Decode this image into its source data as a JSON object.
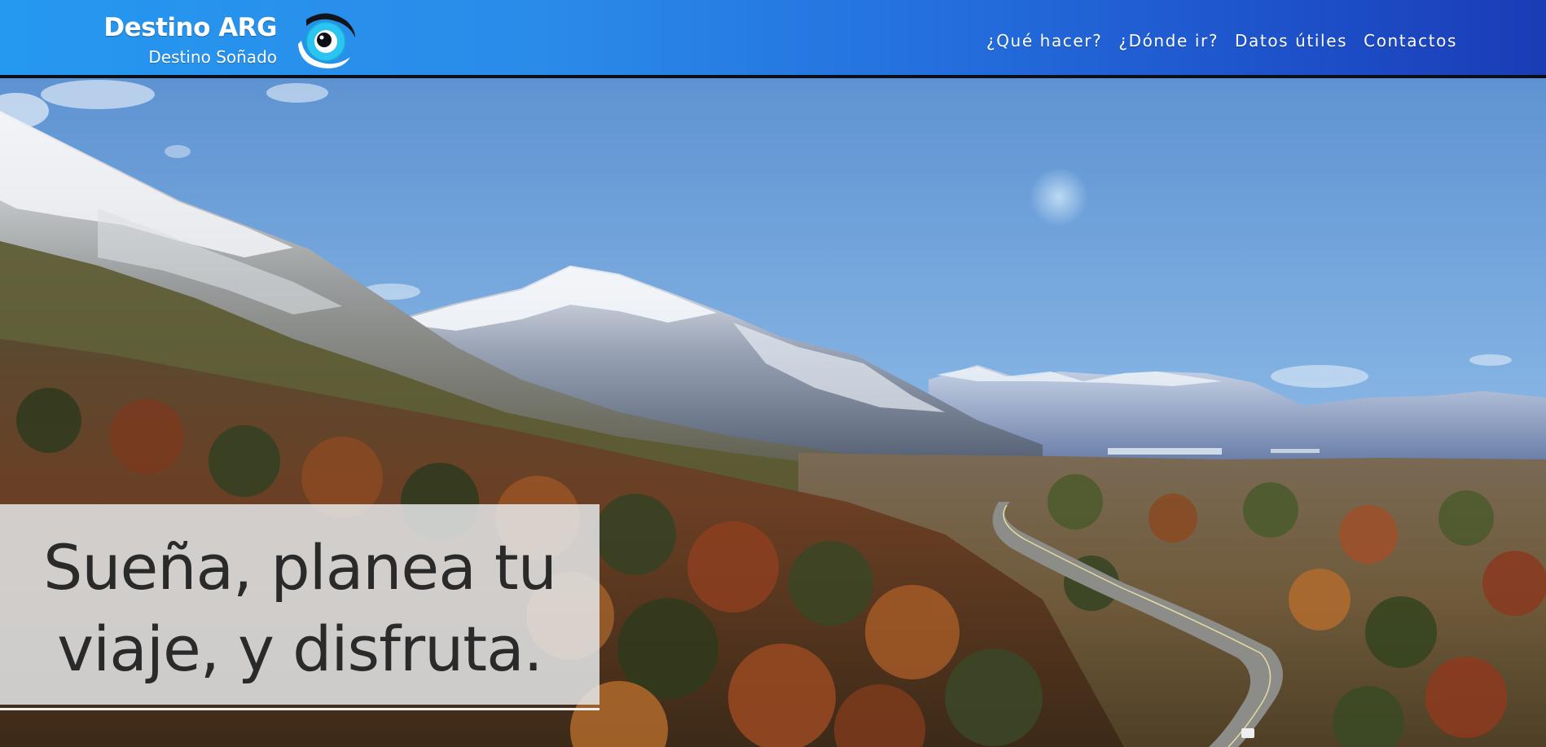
{
  "brand": {
    "title": "Destino ARG",
    "subtitle": "Destino Soñado",
    "logo_icon": "eye-logo-icon"
  },
  "nav": {
    "items": [
      {
        "label": "¿Qué hacer?"
      },
      {
        "label": "¿Dónde ir?"
      },
      {
        "label": "Datos útiles"
      },
      {
        "label": "Contactos"
      }
    ]
  },
  "hero": {
    "tagline_line1": "Sueña, planea tu",
    "tagline_line2": "viaje, y disfruta.",
    "background": "mountain-valley-autumn-forest-road-photo"
  },
  "colors": {
    "header_start": "#2598f0",
    "header_end": "#1a3cb5",
    "logo_iris": "#2cc4f0",
    "tagline_text": "#2a2a2a"
  }
}
